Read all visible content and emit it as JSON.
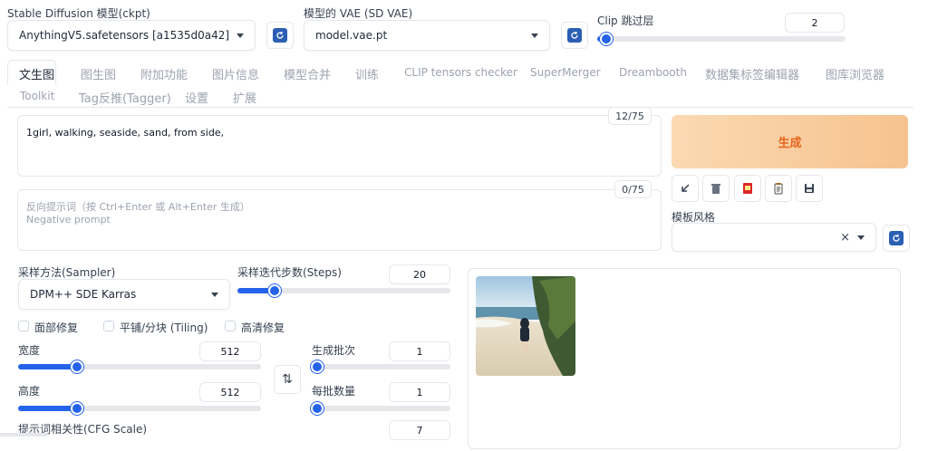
{
  "top": {
    "ckpt": {
      "label": "Stable Diffusion 模型(ckpt)",
      "value": "AnythingV5.safetensors [a1535d0a42]"
    },
    "vae": {
      "label": "模型的 VAE (SD VAE)",
      "value": "model.vae.pt"
    },
    "clip": {
      "label": "Clip 跳过层",
      "value": "2",
      "level_percent": 3
    }
  },
  "tabs_row1": [
    {
      "label": "文生图",
      "active": true
    },
    {
      "label": "图生图"
    },
    {
      "label": "附加功能"
    },
    {
      "label": "图片信息"
    },
    {
      "label": "模型合并"
    },
    {
      "label": "训练"
    },
    {
      "label": "CLIP tensors checker"
    },
    {
      "label": "SuperMerger"
    },
    {
      "label": "Dreambooth"
    },
    {
      "label": "数据集标签编辑器"
    },
    {
      "label": "图库浏览器"
    }
  ],
  "tabs_row2": [
    {
      "label": "Toolkit"
    },
    {
      "label": "Tag反推(Tagger)"
    },
    {
      "label": "设置"
    },
    {
      "label": "扩展"
    }
  ],
  "prompt": {
    "value": "1girl, walking, seaside, sand, from side,",
    "counter": "12/75"
  },
  "negative_prompt": {
    "placeholder_line1": "反向提示词（按 Ctrl+Enter 或 Alt+Enter 生成）",
    "placeholder_line2": "Negative prompt",
    "counter": "0/75"
  },
  "generate": {
    "label": "生成"
  },
  "style": {
    "label": "模板风格",
    "clear": "×"
  },
  "sampler": {
    "label": "采样方法(Sampler)",
    "value": "DPM++ SDE Karras"
  },
  "steps": {
    "label": "采样迭代步数(Steps)",
    "value": "20",
    "level_percent": 17
  },
  "checks": {
    "face": "面部修复",
    "tiling": "平铺/分块 (Tiling)",
    "hires": "高清修复"
  },
  "width": {
    "label": "宽度",
    "value": "512",
    "level_percent": 24
  },
  "height": {
    "label": "高度",
    "value": "512",
    "level_percent": 24
  },
  "batch_count": {
    "label": "生成批次",
    "value": "1",
    "level_percent": 0
  },
  "batch_size": {
    "label": "每批数量",
    "value": "1",
    "level_percent": 0
  },
  "swap": {
    "label": "⇅"
  },
  "cfg": {
    "label": "提示词相关性(CFG Scale)",
    "value": "7"
  },
  "colors": {
    "accent": "#2563eb",
    "generate_text": "#e8641b"
  }
}
